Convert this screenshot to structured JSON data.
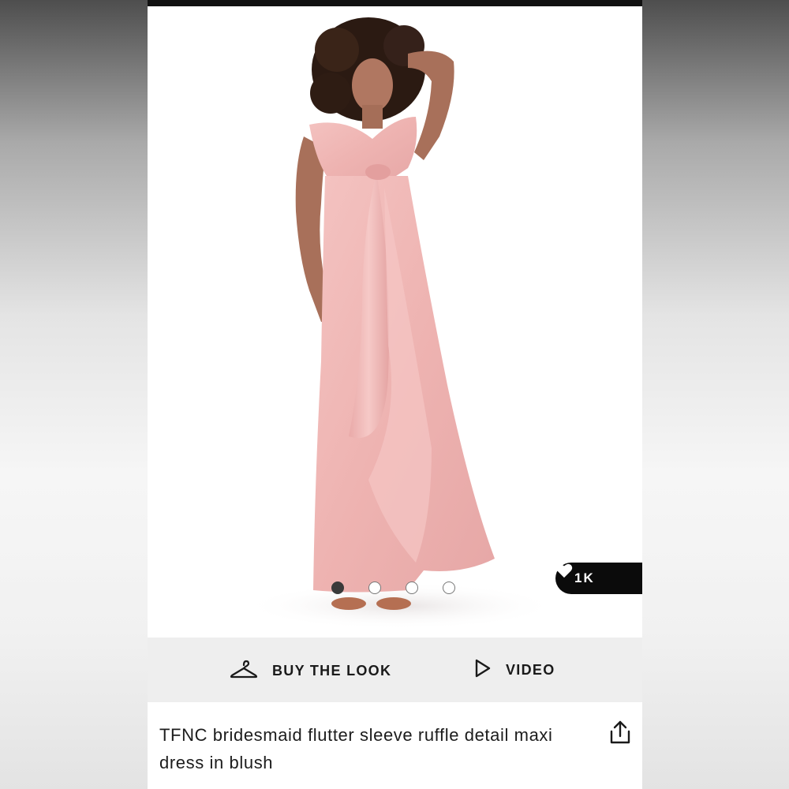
{
  "product": {
    "title": "TFNC bridesmaid flutter sleeve ruffle detail maxi dress in blush",
    "image_alt": "Model wearing blush maxi dress",
    "dress_color": "#f1b9b7"
  },
  "carousel": {
    "total_images": 4,
    "active_index": 0
  },
  "likes": {
    "count": "1K",
    "icon": "heart-icon"
  },
  "actions": {
    "buy_the_look_label": "BUY THE LOOK",
    "buy_the_look_icon": "hanger-icon",
    "video_label": "VIDEO",
    "video_icon": "play-icon"
  },
  "share": {
    "icon": "share-icon"
  },
  "colors": {
    "top_bar": "#111111",
    "action_bar_bg": "#eeeeee",
    "likes_pill_bg": "#0b0b0b"
  }
}
